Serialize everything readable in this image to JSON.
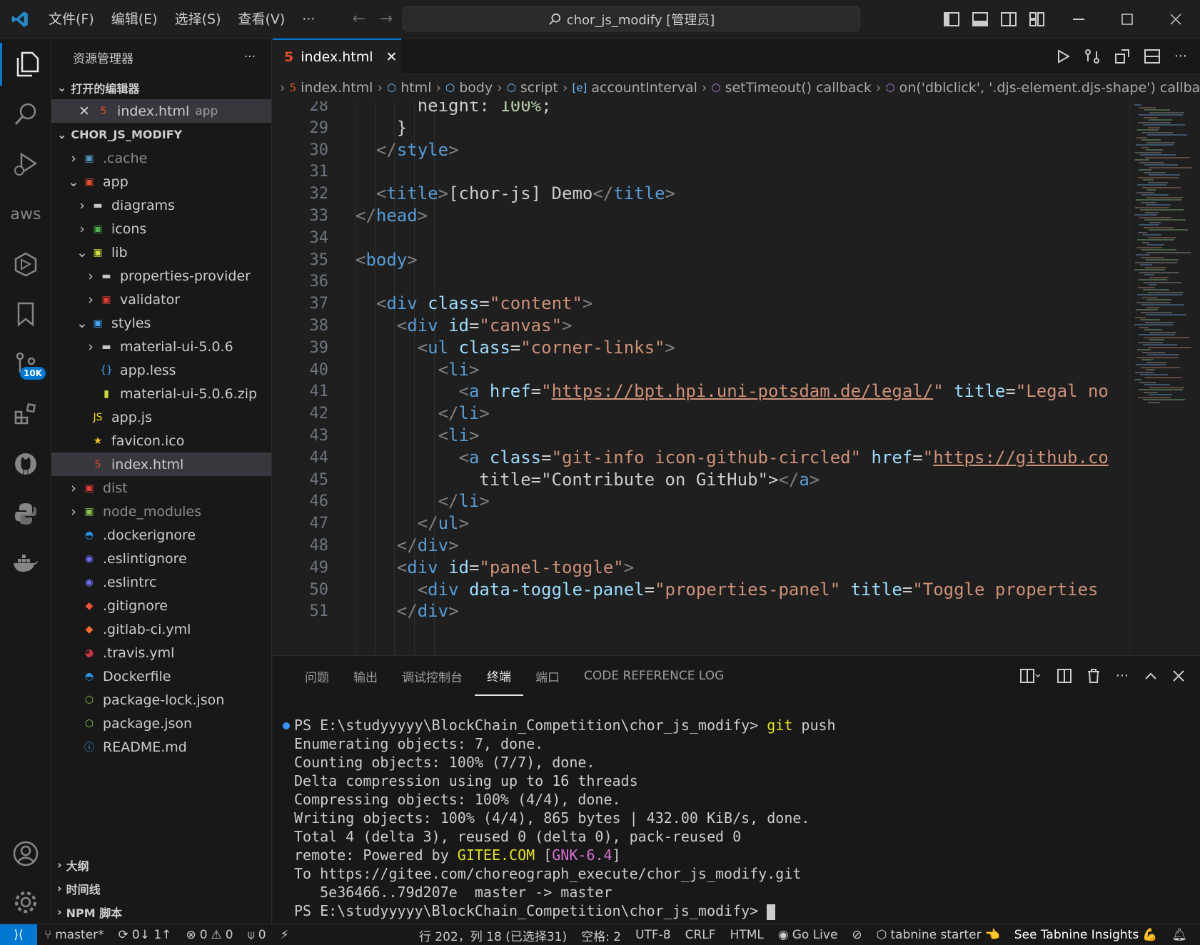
{
  "menu": [
    "文件(F)",
    "编辑(E)",
    "选择(S)",
    "查看(V)",
    "···"
  ],
  "command_center": "chor_js_modify [管理员]",
  "activity": {
    "badge": "10K",
    "aws_label": "aws"
  },
  "sidebar": {
    "title": "资源管理器",
    "more": "···",
    "open_editors": "打开的编辑器",
    "open_file": {
      "name": "index.html",
      "desc": "app"
    },
    "project": "CHOR_JS_MODIFY",
    "tree": [
      {
        "name": ".cache",
        "depth": 0,
        "dim": true,
        "folder": true
      },
      {
        "name": "app",
        "depth": 0,
        "folder": true,
        "open": true
      },
      {
        "name": "diagrams",
        "depth": 1,
        "folder": true
      },
      {
        "name": "icons",
        "depth": 1,
        "folder": true
      },
      {
        "name": "lib",
        "depth": 1,
        "folder": true,
        "open": true
      },
      {
        "name": "properties-provider",
        "depth": 2,
        "folder": true
      },
      {
        "name": "validator",
        "depth": 2,
        "folder": true
      },
      {
        "name": "styles",
        "depth": 1,
        "folder": true,
        "open": true
      },
      {
        "name": "material-ui-5.0.6",
        "depth": 2,
        "folder": true
      },
      {
        "name": "app.less",
        "depth": 2
      },
      {
        "name": "material-ui-5.0.6.zip",
        "depth": 2
      },
      {
        "name": "app.js",
        "depth": 1
      },
      {
        "name": "favicon.ico",
        "depth": 1
      },
      {
        "name": "index.html",
        "depth": 1,
        "selected": true
      },
      {
        "name": "dist",
        "depth": 0,
        "dim": true,
        "folder": true
      },
      {
        "name": "node_modules",
        "depth": 0,
        "dim": true,
        "folder": true
      },
      {
        "name": ".dockerignore",
        "depth": 0
      },
      {
        "name": ".eslintignore",
        "depth": 0
      },
      {
        "name": ".eslintrc",
        "depth": 0
      },
      {
        "name": ".gitignore",
        "depth": 0
      },
      {
        "name": ".gitlab-ci.yml",
        "depth": 0
      },
      {
        "name": ".travis.yml",
        "depth": 0
      },
      {
        "name": "Dockerfile",
        "depth": 0
      },
      {
        "name": "package-lock.json",
        "depth": 0
      },
      {
        "name": "package.json",
        "depth": 0
      },
      {
        "name": "README.md",
        "depth": 0
      }
    ],
    "outline": "大纲",
    "timeline": "时间线",
    "npm": "NPM 脚本"
  },
  "tab": {
    "label": "index.html"
  },
  "breadcrumb": [
    "index.html",
    "html",
    "body",
    "script",
    "accountInterval",
    "setTimeout() callback",
    "on('dblclick', '.djs-element.djs-shape') callback"
  ],
  "editor": {
    "line_numbers": [
      "28",
      "29",
      "30",
      "31",
      "32",
      "33",
      "34",
      "35",
      "36",
      "37",
      "38",
      "39",
      "40",
      "41",
      "42",
      "43",
      "44",
      "45",
      "46",
      "47",
      "48",
      "49",
      "50",
      "51"
    ],
    "lines": [
      "      height: 100%;",
      "    }",
      "  </style>",
      "",
      "  <title>[chor-js] Demo</title>",
      "</head>",
      "",
      "<body>",
      "",
      "  <div class=\"content\">",
      "    <div id=\"canvas\">",
      "      <ul class=\"corner-links\">",
      "        <li>",
      "          <a href=\"https://bpt.hpi.uni-potsdam.de/legal/\" title=\"Legal no",
      "        </li>",
      "        <li>",
      "          <a class=\"git-info icon-github-circled\" href=\"https://github.co",
      "            title=\"Contribute on GitHub\"></a>",
      "        </li>",
      "      </ul>",
      "    </div>",
      "    <div id=\"panel-toggle\">",
      "      <div data-toggle-panel=\"properties-panel\" title=\"Toggle properties",
      "    </div>"
    ]
  },
  "panel": {
    "tabs": [
      "问题",
      "输出",
      "调试控制台",
      "终端",
      "端口",
      "CODE REFERENCE LOG"
    ],
    "active_tab": "终端",
    "terminal": {
      "prompt": "PS E:\\studyyyyy\\BlockChain_Competition\\chor_js_modify>",
      "cmd_git": "git",
      "cmd_rest": " push",
      "lines": [
        "Enumerating objects: 7, done.",
        "Counting objects: 100% (7/7), done.",
        "Delta compression using up to 16 threads",
        "Compressing objects: 100% (4/4), done.",
        "Writing objects: 100% (4/4), 865 bytes | 432.00 KiB/s, done.",
        "Total 4 (delta 3), reused 0 (delta 0), pack-reused 0"
      ],
      "remote_prefix": "remote: Powered by ",
      "remote_host": "GITEE.COM",
      "remote_open": " [",
      "remote_tag": "GNK-6.4",
      "remote_close": "]",
      "to_line": "To https://gitee.com/choreograph_execute/chor_js_modify.git",
      "refs_line": "   5e36466..79d207e  master -> master",
      "final_prompt": "PS E:\\studyyyyy\\BlockChain_Competition\\chor_js_modify>"
    }
  },
  "status": {
    "branch": "master*",
    "sync": "0↓ 1↑",
    "errors": "0",
    "warnings": "0",
    "ports": "0",
    "position": "行 202，列 18 (已选择31)",
    "spaces": "空格: 2",
    "encoding": "UTF-8",
    "eol": "CRLF",
    "language": "HTML",
    "golive": "Go Live",
    "tabnine": "tabnine starter",
    "insights": "See Tabnine Insights"
  }
}
